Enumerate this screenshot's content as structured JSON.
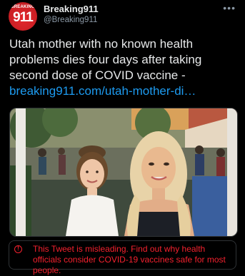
{
  "account": {
    "avatar_top": "BREAKING",
    "avatar_main": "911",
    "display_name": "Breaking911",
    "handle": "@Breaking911",
    "more_icon": "more-horizontal-icon"
  },
  "tweet": {
    "text": "Utah mother with no known health problems dies four days after taking second dose of COVID vaccine - ",
    "link": "breaking911.com/utah-mother-di…"
  },
  "media": {
    "description_icon": "photo"
  },
  "warning": {
    "icon": "exclamation-circle-icon",
    "text": "This Tweet is misleading. Find out why health officials consider COVID-19 vaccines safe for most people."
  },
  "colors": {
    "background": "#000000",
    "link": "#1d9bf0",
    "warning": "#f4212e",
    "secondary_text": "#8b98a5"
  }
}
